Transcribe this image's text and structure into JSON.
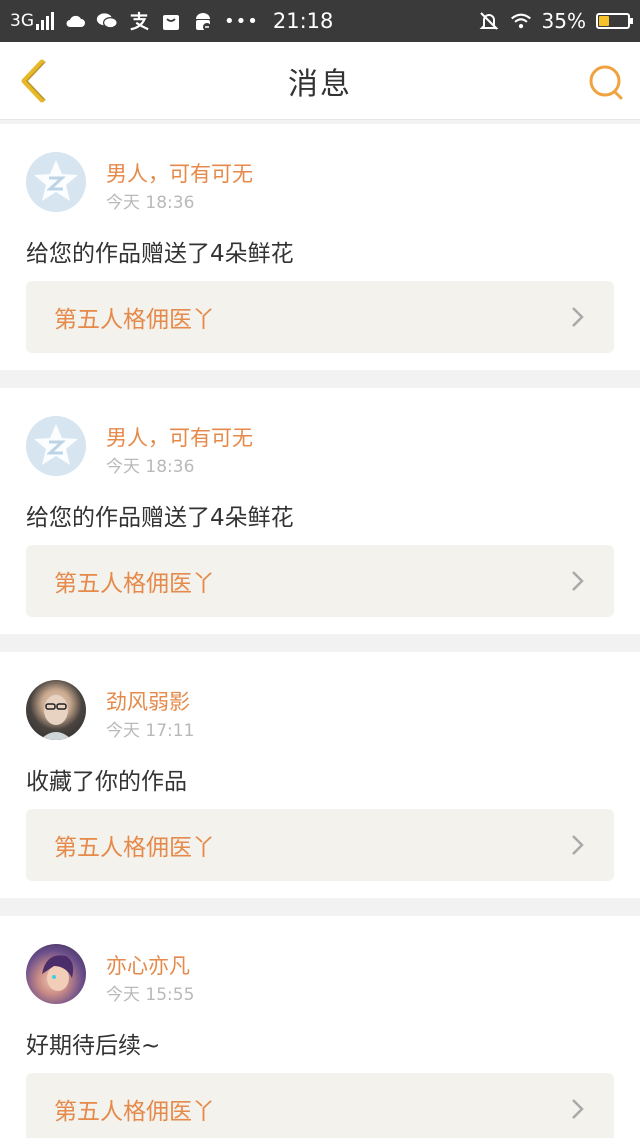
{
  "status_bar": {
    "network": "3G",
    "time": "21:18",
    "battery": "35%",
    "battery_level": 0.35
  },
  "nav": {
    "title": "消息",
    "back_icon": "chevron-left-icon",
    "search_icon": "search-icon"
  },
  "colors": {
    "accent": "#e58a4a",
    "nav_icon": "#f0a240",
    "back_icon": "#e6b82a",
    "link_bg": "#f3f2ed",
    "status_bg": "#3a3a3a"
  },
  "notifications": [
    {
      "user": "男人，可有可无",
      "time": "今天 18:36",
      "message": "给您的作品赠送了4朵鲜花",
      "work": "第五人格佣医丫",
      "avatar": "default"
    },
    {
      "user": "男人，可有可无",
      "time": "今天 18:36",
      "message": "给您的作品赠送了4朵鲜花",
      "work": "第五人格佣医丫",
      "avatar": "default"
    },
    {
      "user": "劲风弱影",
      "time": "今天 17:11",
      "message": "收藏了你的作品",
      "work": "第五人格佣医丫",
      "avatar": "photo1"
    },
    {
      "user": "亦心亦凡",
      "time": "今天 15:55",
      "message": "好期待后续~",
      "work": "第五人格佣医丫",
      "avatar": "photo2"
    }
  ]
}
